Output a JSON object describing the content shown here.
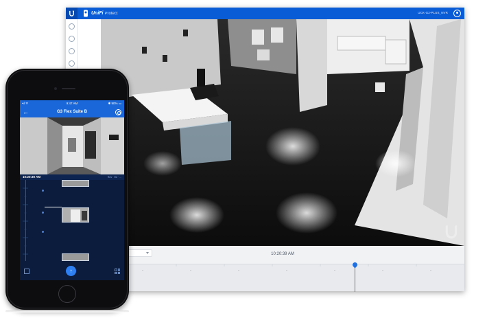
{
  "desktop": {
    "brand": {
      "name": "UniFi",
      "product": "Protect"
    },
    "device_name": "UCK-G2-PLUS_NVR",
    "sidebar_icons": [
      "cameras-icon",
      "video-icon",
      "settings-icon",
      "search-icon"
    ],
    "playback_time": "10:20:39 AM"
  },
  "phone": {
    "status": {
      "signal": "•ıl ᯤ",
      "time": "9:47 AM",
      "battery": "✱ 90% ▭"
    },
    "title": "G3 Flex Suite B",
    "live_time": "10:20:30 AM",
    "live_options": "Res · Vol · ..."
  },
  "colors": {
    "accent": "#0a5bd6",
    "phone_bg": "#0b1c3d",
    "playhead": "#2f80ed"
  }
}
